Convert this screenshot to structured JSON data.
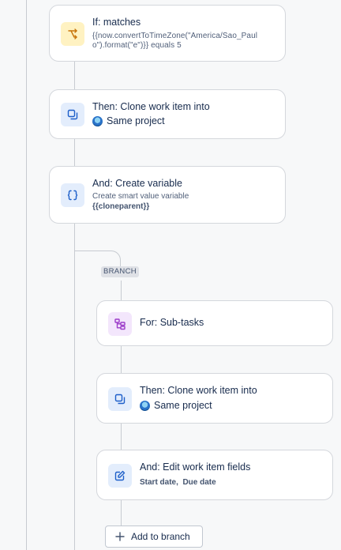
{
  "cards": {
    "condition": {
      "title": "If: matches",
      "detail_line1": "{{now.convertToTimeZone(\"America/Sao_Paul",
      "detail_line2": "o\").format(\"e\")}} equals 5"
    },
    "clone_top": {
      "title": "Then: Clone work item into",
      "project": "Same project"
    },
    "create_variable": {
      "title": "And: Create variable",
      "subtitle": "Create smart value variable",
      "variable": "{{cloneparent}}"
    },
    "for_subtasks": {
      "title": "For: Sub-tasks"
    },
    "clone_branch": {
      "title": "Then: Clone work item into",
      "project": "Same project"
    },
    "edit_fields": {
      "title": "And: Edit work item fields",
      "fields": "Start date,  Due date"
    }
  },
  "branch": {
    "tag": "BRANCH"
  },
  "add_to_branch": {
    "label": "Add to branch"
  },
  "icons": {
    "condition": "branch-condition-icon",
    "clone": "clone-icon",
    "variable": "braces-icon",
    "subtasks": "subtasks-icon",
    "edit": "edit-icon",
    "add": "plus-icon"
  },
  "colors": {
    "yellow_icon_bg": "#fff2c2",
    "blue_icon_bg": "#e3edfc",
    "purple_icon_bg": "#f3e6fc"
  }
}
